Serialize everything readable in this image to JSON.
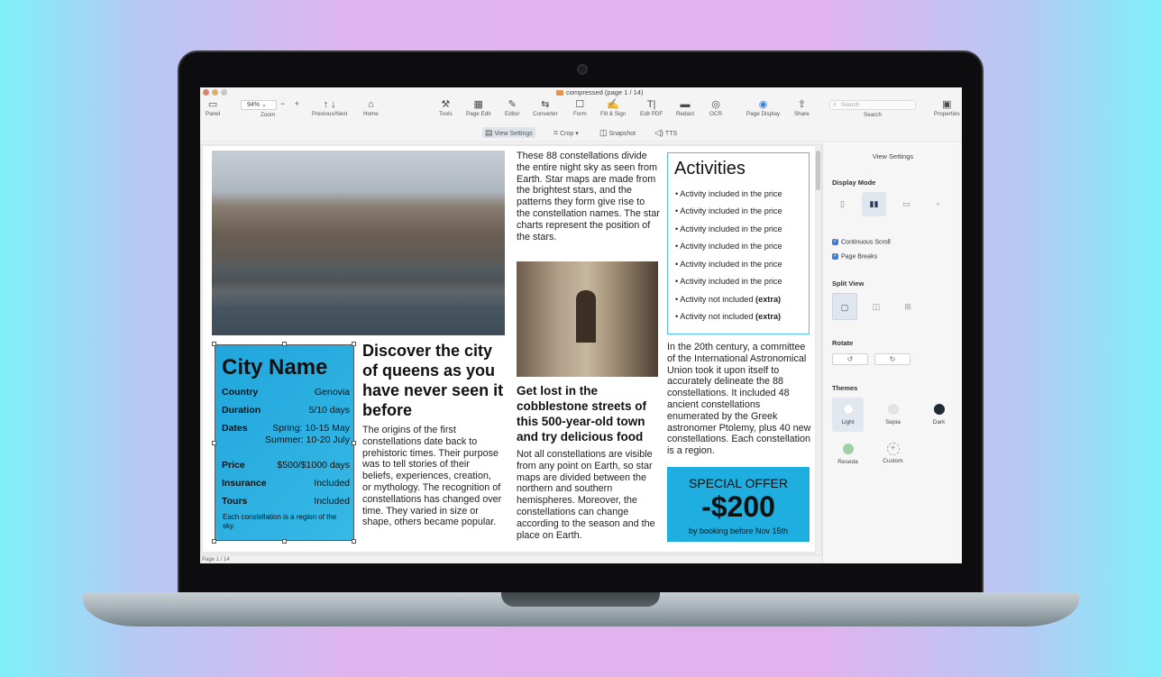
{
  "window": {
    "doc_title": "compressed (page 1 / 14)"
  },
  "toolbar": {
    "zoom_value": "94%",
    "zoom_minus_plus": "− +",
    "items": [
      {
        "label": "Panel",
        "glyph": "▭"
      },
      {
        "label": "Zoom",
        "glyph": ""
      },
      {
        "label": "Previous/Next",
        "glyph": "↑ ↓"
      },
      {
        "label": "Home",
        "glyph": "⌂"
      },
      {
        "label": "Tools",
        "glyph": "⚒"
      },
      {
        "label": "Page Edit",
        "glyph": "▦"
      },
      {
        "label": "Editor",
        "glyph": "✎"
      },
      {
        "label": "Converter",
        "glyph": "⇆"
      },
      {
        "label": "Form",
        "glyph": "☐"
      },
      {
        "label": "Fill & Sign",
        "glyph": "✍"
      },
      {
        "label": "Edit PDF",
        "glyph": "T|"
      },
      {
        "label": "Redact",
        "glyph": "▬"
      },
      {
        "label": "OCR",
        "glyph": "◎"
      },
      {
        "label": "Page Display",
        "glyph": "◉"
      },
      {
        "label": "Share",
        "glyph": "⇪"
      },
      {
        "label": "Search",
        "glyph": ""
      },
      {
        "label": "Properties",
        "glyph": "▣"
      }
    ],
    "search_placeholder": "Search"
  },
  "subtoolbar": {
    "view_settings": "View Settings",
    "crop": "Crop",
    "snapshot": "Snapshot",
    "tts": "TTS"
  },
  "page": {
    "city_card": {
      "title": "City Name",
      "rows": [
        {
          "key": "Country",
          "value": "Genovia"
        },
        {
          "key": "Duration",
          "value": "5/10 days"
        },
        {
          "key": "Dates",
          "value": "Spring: 10-15 May Summer: 10-20 July"
        },
        {
          "key": "Price",
          "value": "$500/$1000 days"
        },
        {
          "key": "Insurance",
          "value": "Included"
        },
        {
          "key": "Tours",
          "value": "Included"
        }
      ],
      "note": "Each constellation is a region of the sky."
    },
    "discover_title": "Discover the city of queens as you have never seen it before",
    "discover_body": "The origins of the first constellations date back to prehistoric times. Their purpose was to tell stories of their beliefs, experiences, creation, or mythology. The recognition of constellations has changed over time. They varied in size or shape, others became popular.",
    "col2_top": "These 88 constellations divide the entire night sky as seen from Earth. Star maps are made from the brightest stars, and the patterns they form give rise to the constellation names. The star charts represent the position of the stars.",
    "lost_title": "Get lost in the cobblestone streets of this 500-year-old town and try delicious food",
    "lost_body": "Not all constellations are visible from any point on Earth, so star maps are divided between the northern and southern hemispheres. Moreover, the constellations can change according to the season and the place on Earth.",
    "activities": {
      "title": "Activities",
      "items": [
        "• Activity included in the price",
        "• Activity included in the price",
        "• Activity included in the price",
        "• Activity included in the price",
        "• Activity included in the price",
        "• Activity included in the price",
        "• Activity not included",
        "• Activity not included"
      ],
      "extra": "(extra)"
    },
    "col3_body": "In the 20th century, a committee of the International Astronomical Union took it upon itself to accurately delineate the 88 constellations. It included 48 ancient constellations enumerated by the Greek astronomer Ptolemy, plus 40 new constellations. Each constellation is a region.",
    "offer": {
      "line1": "SPECIAL OFFER",
      "line2": "-$200",
      "line3": "by booking before Nov 15th"
    }
  },
  "statusbar": {
    "page": "Page 1 / 14"
  },
  "panel": {
    "title": "View Settings",
    "display_mode": "Display Mode",
    "continuous_scroll": "Continuous Scroll",
    "page_breaks": "Page Breaks",
    "split_view": "Split View",
    "rotate": "Rotate",
    "themes_label": "Themes",
    "themes": [
      {
        "name": "Light",
        "color": "#ffffff"
      },
      {
        "name": "Sepia",
        "color": "#e3e3e3"
      },
      {
        "name": "Dark",
        "color": "#1f2a33"
      },
      {
        "name": "Reseda",
        "color": "#9fd0a3"
      },
      {
        "name": "Custom",
        "color": ""
      }
    ]
  },
  "colors": {
    "accent_blue": "#21a6dc",
    "activities_border": "#4bc1e8"
  }
}
